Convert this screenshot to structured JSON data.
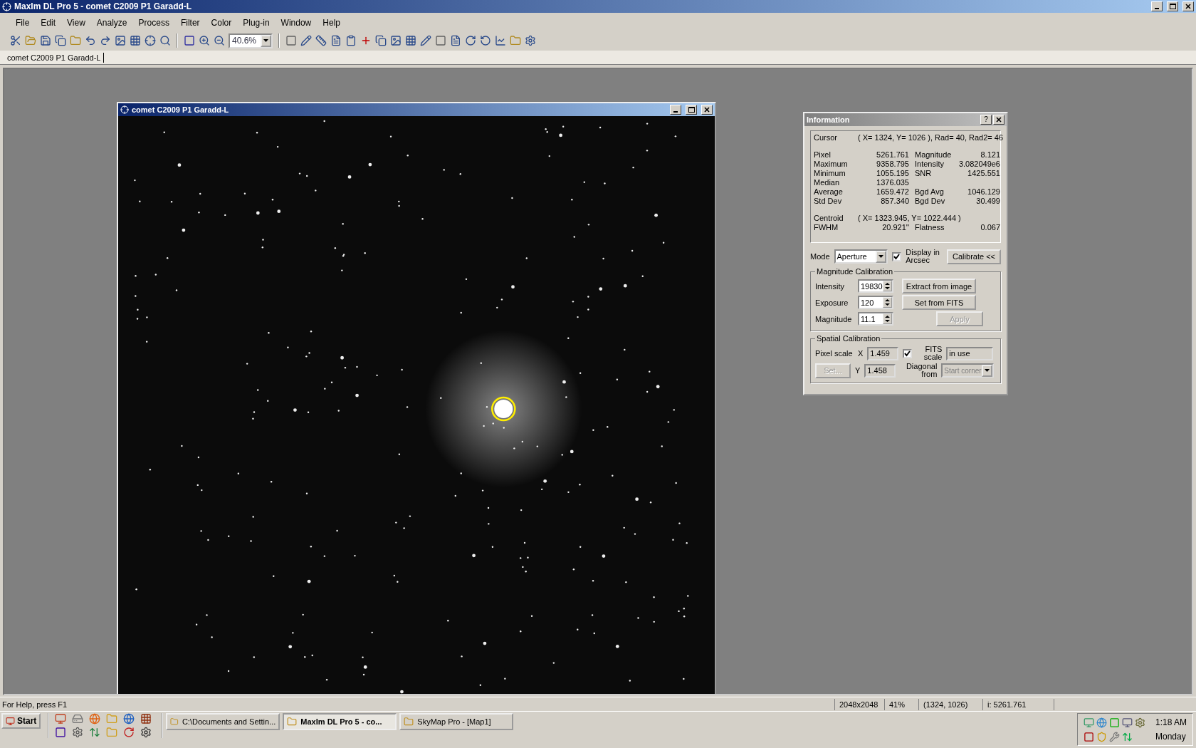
{
  "window": {
    "title": "MaxIm DL Pro 5 - comet C2009 P1 Garadd-L"
  },
  "menu": [
    "File",
    "Edit",
    "View",
    "Analyze",
    "Process",
    "Filter",
    "Color",
    "Plug-in",
    "Window",
    "Help"
  ],
  "toolbar": {
    "zoom": "40.6%"
  },
  "document_tabs": [
    {
      "label": "comet C2009 P1 Garadd-L",
      "selected": true
    }
  ],
  "image_window": {
    "title": "comet C2009 P1 Garadd-L"
  },
  "information": {
    "title": "Information",
    "help": "?",
    "cursor": {
      "label": "Cursor",
      "value": "( X= 1324, Y= 1026 ), Rad= 40, Rad2= 46"
    },
    "stats": [
      {
        "label": "Pixel",
        "value": "5261.761",
        "label2": "Magnitude",
        "value2": "8.121"
      },
      {
        "label": "Maximum",
        "value": "9358.795",
        "label2": "Intensity",
        "value2": "3.082049e6"
      },
      {
        "label": "Minimum",
        "value": "1055.195",
        "label2": "SNR",
        "value2": "1425.551"
      },
      {
        "label": "Median",
        "value": "1376.035"
      },
      {
        "label": "Average",
        "value": "1659.472",
        "label2": "Bgd Avg",
        "value2": "1046.129"
      },
      {
        "label": "Std Dev",
        "value": "857.340",
        "label2": "Bgd Dev",
        "value2": "30.499"
      }
    ],
    "centroid": {
      "label": "Centroid",
      "value": "( X= 1323.945, Y= 1022.444 )"
    },
    "fwhm": {
      "label": "FWHM",
      "value": "20.921''",
      "label2": "Flatness",
      "value2": "0.067"
    },
    "mode": {
      "label": "Mode",
      "value": "Aperture"
    },
    "display_arcsec": {
      "label": "Display in Arcsec",
      "checked": true
    },
    "calibrate_button": "Calibrate <<",
    "magnitude_calibration": {
      "title": "Magnitude Calibration",
      "fields": [
        {
          "label": "Intensity",
          "value": "19830"
        },
        {
          "label": "Exposure",
          "value": "120"
        },
        {
          "label": "Magnitude",
          "value": "11.1"
        }
      ],
      "buttons": [
        {
          "label": "Extract from image",
          "disabled": false
        },
        {
          "label": "Set from FITS",
          "disabled": false
        },
        {
          "label": "Apply",
          "disabled": true
        }
      ]
    },
    "spatial_calibration": {
      "title": "Spatial Calibration",
      "pixel_scale_label": "Pixel scale",
      "x_label": "X",
      "x_value": "1.459",
      "y_label": "Y",
      "y_value": "1.458",
      "set_button": {
        "label": "Set...",
        "disabled": true
      },
      "fits_scale": {
        "label": "FITS scale",
        "checked": true
      },
      "fits_status": "in use",
      "diagonal_label": "Diagonal from",
      "diagonal_value": "Start corner",
      "diagonal_disabled": true
    }
  },
  "status_bar": {
    "help": "For Help, press F1",
    "fields": [
      "2048x2048",
      "41%",
      "(1324, 1026)",
      "i:  5261.761"
    ]
  },
  "taskbar": {
    "start": "Start",
    "tasks": [
      {
        "label": "C:\\Documents and Settin...",
        "selected": false
      },
      {
        "label": "MaxIm DL Pro 5 - co...",
        "selected": true
      },
      {
        "label": "SkyMap Pro - [Map1]",
        "selected": false
      }
    ],
    "time": "1:18 AM",
    "day": "Monday"
  }
}
